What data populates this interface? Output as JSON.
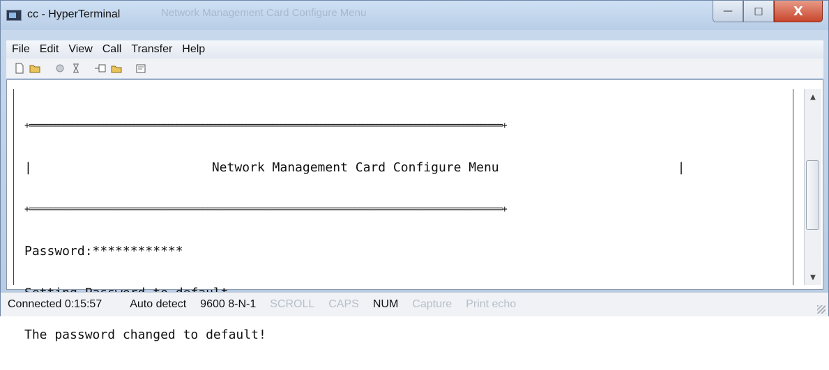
{
  "window": {
    "title": "cc - HyperTerminal",
    "ghost_title": "Network Management Card Configure Menu",
    "minimize_glyph": "—",
    "maximize_glyph": "□",
    "close_glyph": "X"
  },
  "menubar": {
    "items": [
      "File",
      "Edit",
      "View",
      "Call",
      "Transfer",
      "Help"
    ]
  },
  "toolbar": {
    "icons": [
      "new-icon",
      "open-icon",
      "disconnect-icon",
      "dial-icon",
      "send-icon",
      "receive-icon",
      "properties-icon"
    ]
  },
  "terminal": {
    "rule": "+=============================================================================================================+",
    "header_left": "|",
    "header_title": "Network Management Card Configure Menu",
    "header_right": "|",
    "lines": [
      "Password:************",
      "Setting Password to default...",
      "The password changed to default!"
    ]
  },
  "scrollbar": {
    "up_glyph": "▲",
    "down_glyph": "▼"
  },
  "statusbar": {
    "connected": "Connected 0:15:57",
    "detect": "Auto detect",
    "settings": "9600 8-N-1",
    "scroll": "SCROLL",
    "caps": "CAPS",
    "num": "NUM",
    "capture": "Capture",
    "print_echo": "Print echo"
  }
}
